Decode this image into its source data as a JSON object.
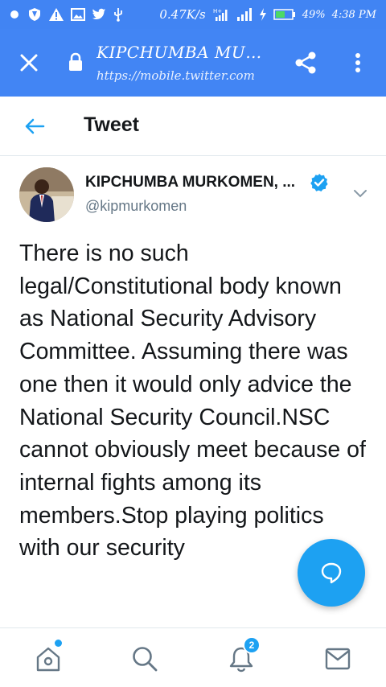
{
  "status_bar": {
    "speed": "0.47K/s",
    "battery": "49%",
    "time": "4:38 PM"
  },
  "browser": {
    "title": "KIPCHUMBA MURKO...",
    "url": "https://mobile.twitter.com"
  },
  "header": {
    "title": "Tweet"
  },
  "tweet": {
    "author_name": "KIPCHUMBA MURKOMEN, ...",
    "handle": "@kipmurkomen",
    "text": "There is no such legal/Constitutional body known as National Security Advisory Committee. Assuming there was one then it would only advice the National Security Council.NSC cannot obviously meet because of internal fights among its members.Stop playing politics with our security"
  },
  "bottom_nav": {
    "notification_count": "2"
  },
  "colors": {
    "status_bar": "#4184f3",
    "browser_bar": "#4285f4",
    "accent": "#1da1f2",
    "text": "#14171a",
    "secondary_text": "#657786"
  },
  "icons": {
    "status": [
      "notification-icon",
      "alert-icon",
      "image-icon",
      "twitter-icon",
      "usb-icon",
      "signal-icon",
      "charging-icon",
      "battery-icon"
    ],
    "browser": [
      "close-icon",
      "lock-icon",
      "share-icon",
      "more-vert-icon"
    ],
    "nav": [
      "home-icon",
      "search-icon",
      "bell-icon",
      "mail-icon"
    ]
  }
}
